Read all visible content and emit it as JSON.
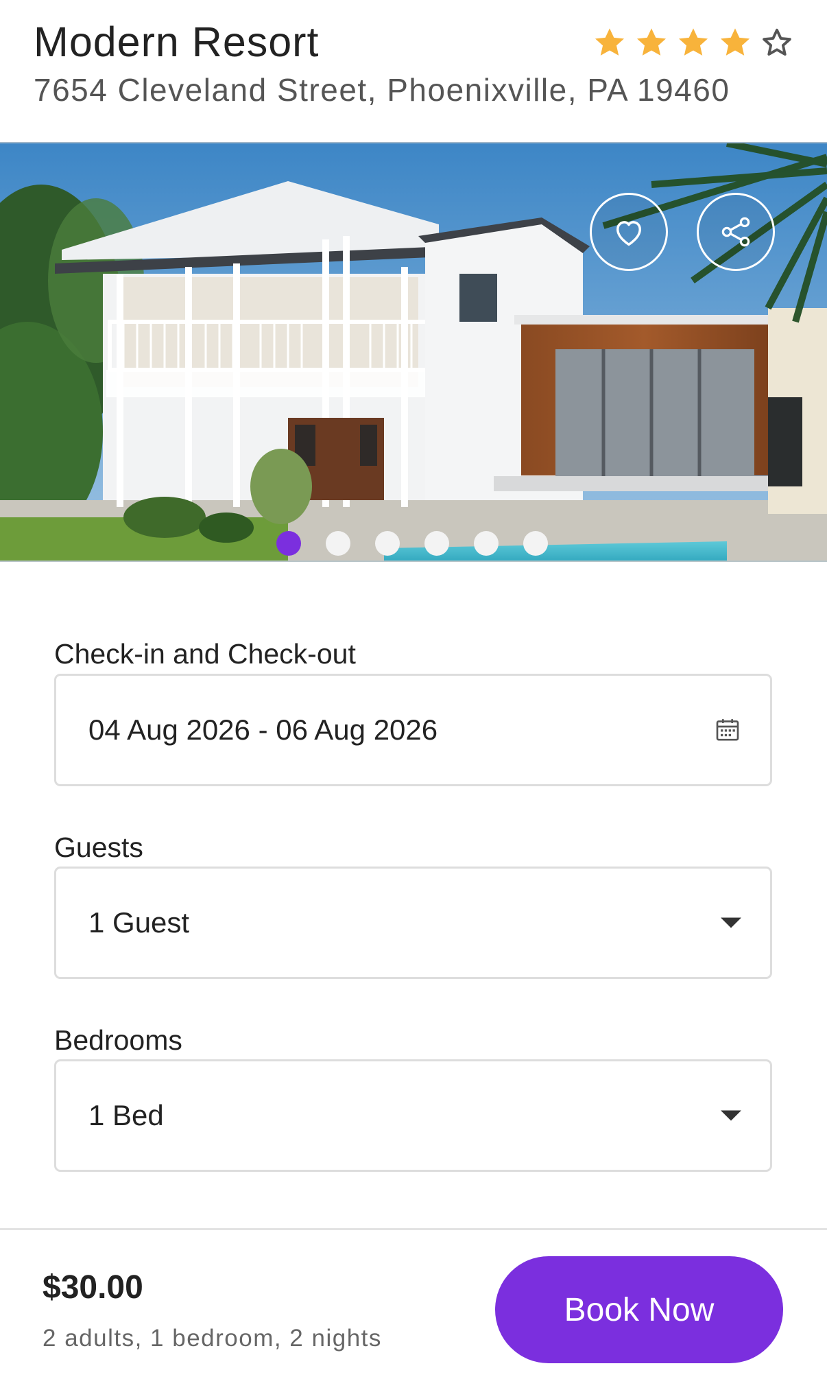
{
  "header": {
    "title": "Modern Resort",
    "address": "7654 Cleveland Street, Phoenixville, PA 19460",
    "rating": 4,
    "rating_max": 5,
    "star_color": "#f8b33b",
    "star_empty_color": "#555555"
  },
  "gallery": {
    "image_description_icon": "property-photo",
    "favorite_icon": "heart-icon",
    "share_icon": "share-icon",
    "slide_count": 6,
    "active_slide": 1,
    "active_dot_color": "#7b2fde"
  },
  "form": {
    "dates": {
      "label": "Check-in and Check-out",
      "value": "04 Aug 2026 - 06 Aug 2026",
      "icon": "calendar-icon"
    },
    "guests": {
      "label": "Guests",
      "value": "1 Guest",
      "icon": "dropdown-caret-icon"
    },
    "bedrooms": {
      "label": "Bedrooms",
      "value": "1 Bed",
      "icon": "dropdown-caret-icon"
    }
  },
  "footer": {
    "price": "$30.00",
    "summary": "2 adults, 1 bedroom, 2 nights",
    "book_label": "Book Now",
    "accent_color": "#7b2fde"
  }
}
